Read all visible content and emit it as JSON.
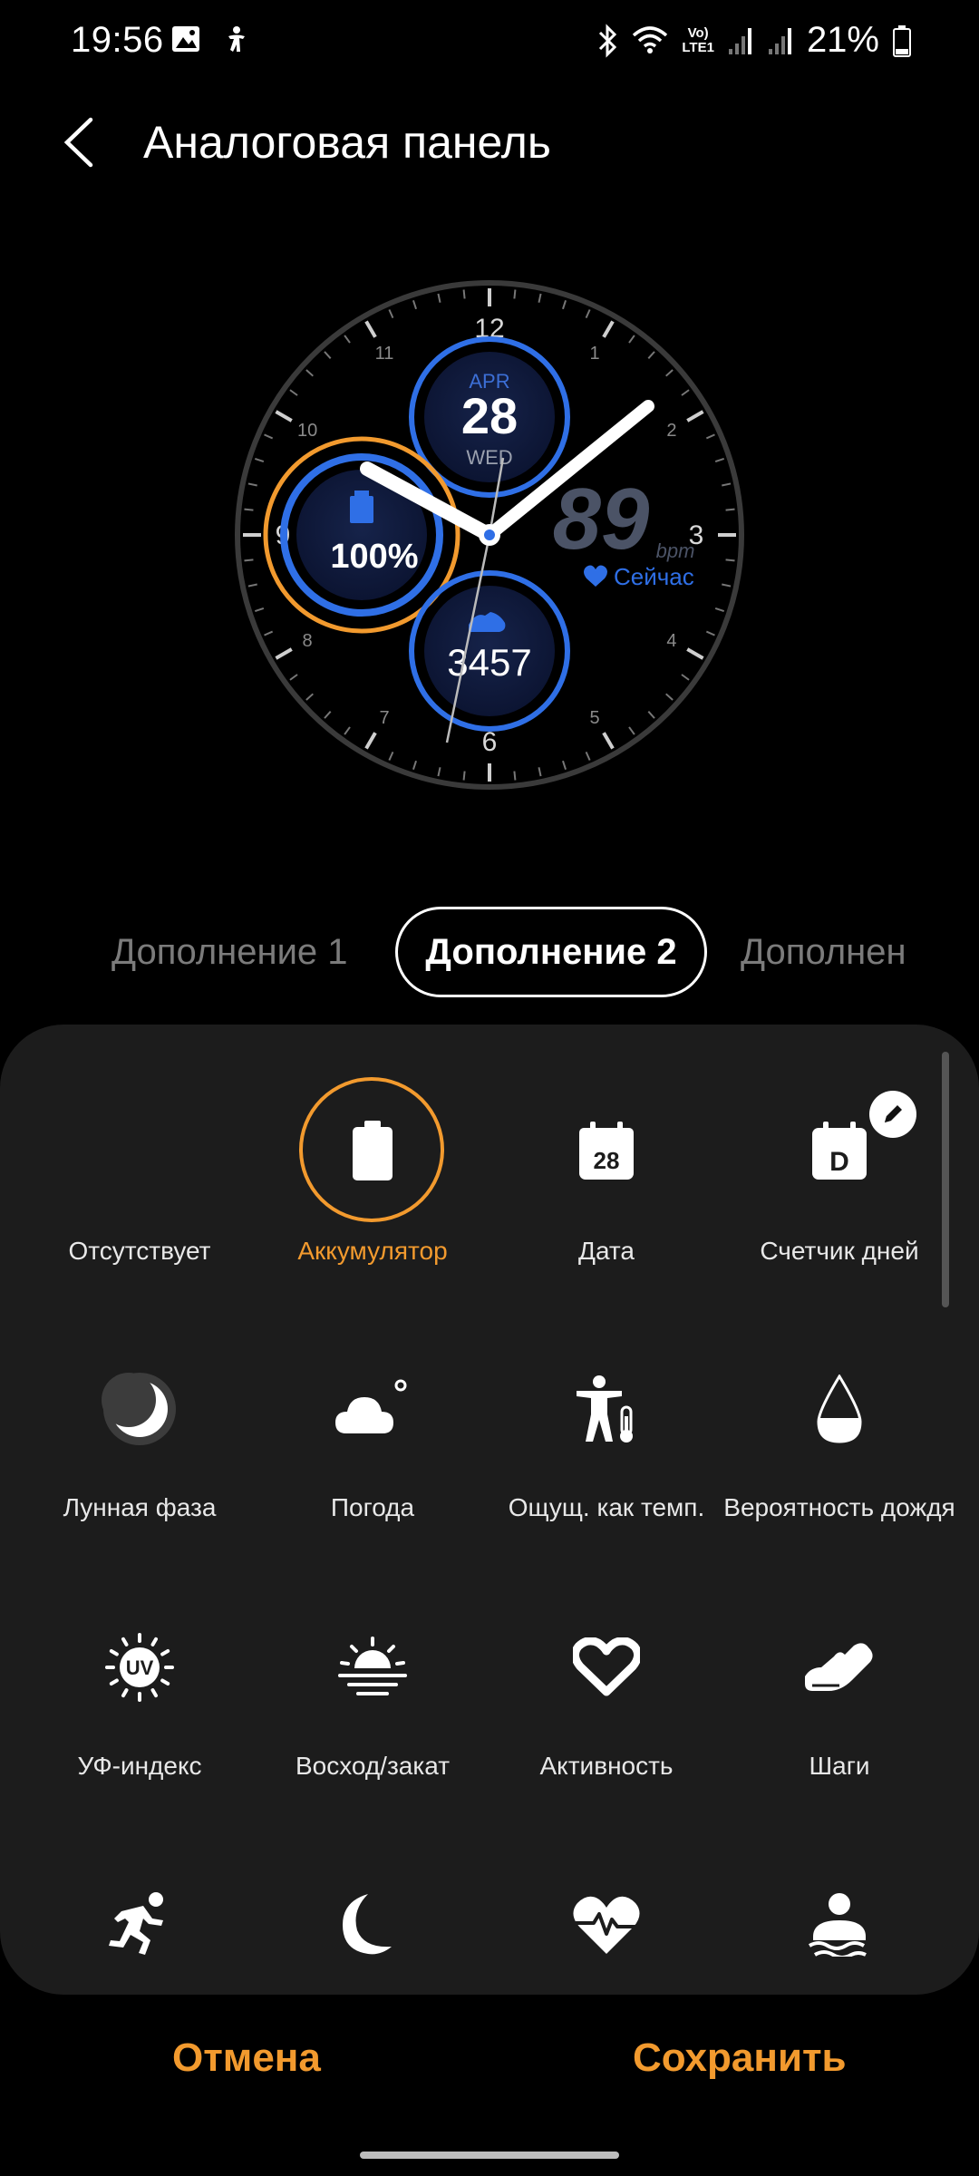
{
  "status_bar": {
    "time": "19:56",
    "left_icons": [
      "image-icon",
      "accessibility-icon"
    ],
    "right_icons": [
      "bluetooth-icon",
      "wifi-icon",
      "volte-icon",
      "signal-icon",
      "signal-icon",
      "battery-icon"
    ],
    "network_label": "Vo)\nLTE1",
    "battery": "21%"
  },
  "header": {
    "title": "Аналоговая панель"
  },
  "watch_face": {
    "date_month": "APR",
    "date_day": "28",
    "date_weekday": "WED",
    "heart_rate": "89",
    "heart_unit": "bpm",
    "heart_label": "Сейчас",
    "battery_value": "100%",
    "steps": "3457",
    "hour_numbers": [
      "12",
      "1",
      "2",
      "3",
      "4",
      "5",
      "6",
      "7",
      "8",
      "9",
      "10",
      "11"
    ],
    "accent_colors": {
      "blue": "#2f6fe6",
      "orange": "#f29a2e"
    }
  },
  "tabs": [
    {
      "label": "Дополнение 1"
    },
    {
      "label": "Дополнение 2",
      "active": true
    },
    {
      "label": "Дополнен"
    }
  ],
  "complications": [
    {
      "label": "Отсутствует",
      "icon": "none"
    },
    {
      "label": "Аккумулятор",
      "icon": "battery-icon",
      "selected": true
    },
    {
      "label": "Дата",
      "icon": "calendar-date-icon",
      "icon_text": "28"
    },
    {
      "label": "Счетчик дней",
      "icon": "day-counter-icon",
      "icon_text": "D",
      "editable": true
    },
    {
      "label": "Лунная фаза",
      "icon": "moon-phase-icon"
    },
    {
      "label": "Погода",
      "icon": "weather-icon"
    },
    {
      "label": "Ощущ. как темп.",
      "icon": "feels-like-icon"
    },
    {
      "label": "Вероятность дождя",
      "icon": "rain-drop-icon"
    },
    {
      "label": "УФ-индекс",
      "icon": "uv-index-icon",
      "icon_text": "UV"
    },
    {
      "label": "Восход/закат",
      "icon": "sunrise-icon"
    },
    {
      "label": "Активность",
      "icon": "heart-outline-icon"
    },
    {
      "label": "Шаги",
      "icon": "shoe-icon"
    },
    {
      "label": "",
      "icon": "running-icon"
    },
    {
      "label": "",
      "icon": "sleep-icon"
    },
    {
      "label": "",
      "icon": "heart-rate-icon"
    },
    {
      "label": "",
      "icon": "stress-icon"
    }
  ],
  "buttons": {
    "cancel": "Отмена",
    "save": "Сохранить"
  }
}
